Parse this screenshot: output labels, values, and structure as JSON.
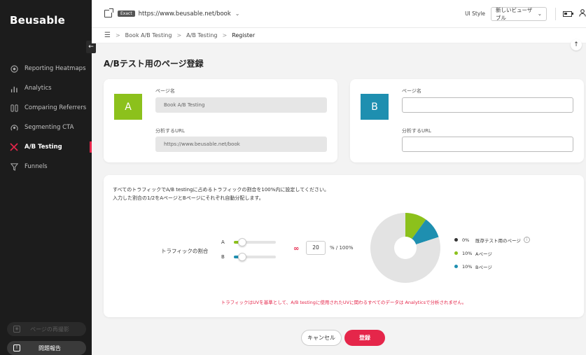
{
  "app": {
    "logo": "Beusable"
  },
  "sidebar": {
    "items": [
      {
        "label": "Reporting Heatmaps",
        "icon": "target-icon"
      },
      {
        "label": "Analytics",
        "icon": "bar-chart-icon"
      },
      {
        "label": "Comparing Referrers",
        "icon": "compare-icon"
      },
      {
        "label": "Segmenting CTA",
        "icon": "segment-icon"
      },
      {
        "label": "A/B Testing",
        "icon": "ab-test-icon",
        "active": true
      },
      {
        "label": "Funnels",
        "icon": "funnel-icon"
      }
    ],
    "reshoot_label": "ページの再撮影",
    "report_label": "問題報告"
  },
  "topbar": {
    "match_badge": "Exact",
    "url": "https://www.beusable.net/book",
    "ui_style_label": "UI Style",
    "ui_style_value": "新しいビューザブル"
  },
  "breadcrumb": {
    "items": [
      "Book A/B Testing",
      "A/B Testing",
      "Register"
    ]
  },
  "page": {
    "title": "A/Bテスト用のページ登録"
  },
  "variant_a": {
    "letter": "A",
    "name_label": "ページ名",
    "name_value": "Book A/B Testing",
    "url_label": "分析するURL",
    "url_value": "https://www.beusable.net/book"
  },
  "variant_b": {
    "letter": "B",
    "name_label": "ページ名",
    "name_value": "",
    "url_label": "分析するURL",
    "url_value": ""
  },
  "traffic": {
    "description_line1": "すべてのトラフィックでA/B testingに占めるトラフィックの割合を100%内に設定してください。",
    "description_line2": "入力した割合の1/2をAページとBページにそれぞれ自動分配します。",
    "label": "トラフィックの割合",
    "slider_a_name": "A",
    "slider_b_name": "B",
    "slider_a_value": 0.1,
    "slider_b_value": 0.1,
    "percent_value": "20",
    "percent_suffix": "%  / 100%",
    "warning": "トラフィックはUVを基準として、A/B testingに使用されたUVに関わるすべてのデータは Analyticsで分析されません。",
    "colors": {
      "a": "#8cc11c",
      "b": "#1e8fb0",
      "existing": "#e3e3e3",
      "accent": "#e5264a"
    }
  },
  "chart_data": {
    "type": "pie",
    "slices": [
      {
        "name": "既存テスト用のページ",
        "pct_label": "0%",
        "value": 80,
        "color": "#e3e3e3"
      },
      {
        "name": "Aページ",
        "pct_label": "10%",
        "value": 10,
        "color": "#8cc11c"
      },
      {
        "name": "Bページ",
        "pct_label": "10%",
        "value": 10,
        "color": "#1e8fb0"
      }
    ]
  },
  "actions": {
    "cancel_label": "キャンセル",
    "register_label": "登録"
  }
}
